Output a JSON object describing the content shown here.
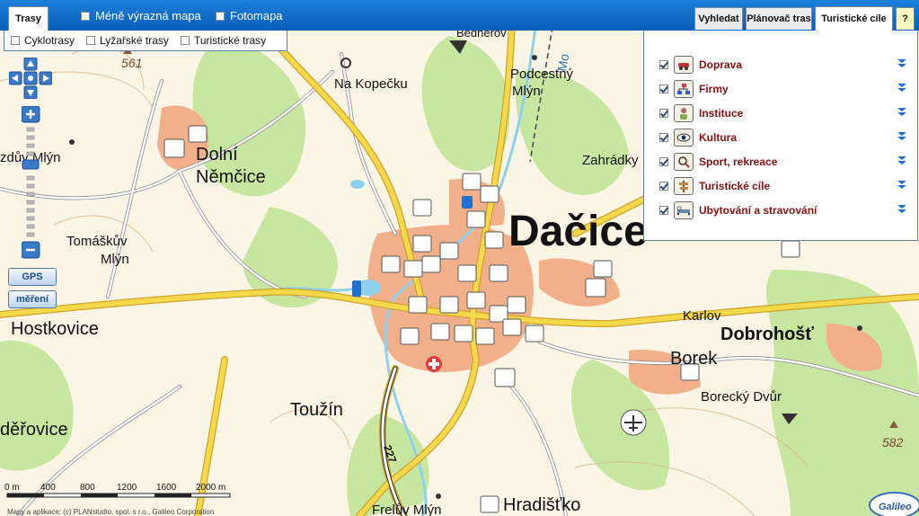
{
  "topbar": {
    "tab_routes": "Trasy",
    "less_map_label": "Méně výrazná mapa",
    "photo_map_label": "Fotomapa",
    "tab_search": "Vyhledat",
    "tab_planner": "Plánovač tras",
    "tab_tourist": "Turistické cíle",
    "tab_help": "?"
  },
  "routes_bar": {
    "cycle": "Cyklotrasy",
    "ski": "Lyžařské trasy",
    "hiking": "Turistické trasy"
  },
  "tourist_panel": {
    "items": [
      {
        "label": "Doprava",
        "icon": "car-icon"
      },
      {
        "label": "Firmy",
        "icon": "org-chart-icon"
      },
      {
        "label": "Instituce",
        "icon": "person-icon"
      },
      {
        "label": "Kultura",
        "icon": "eye-icon"
      },
      {
        "label": "Sport, rekreace",
        "icon": "magnifier-icon"
      },
      {
        "label": "Turistické cíle",
        "icon": "signpost-icon"
      },
      {
        "label": "Ubytování a stravování",
        "icon": "bed-icon"
      }
    ]
  },
  "controls": {
    "gps": "GPS",
    "measure": "měření"
  },
  "map_labels": {
    "dolni_nemcice_1": "Dolní",
    "dolni_nemcice_2": "Němčice",
    "na_kopecku": "Na Kopečku",
    "podcestny_1": "Podcestný",
    "podcestny_2": "Mlýn",
    "zahradky": "Zahrádky",
    "dacice": "Dačice",
    "zdov_mlyn": "zdův Mlýn",
    "tomaskuv_1": "Tomáškův",
    "tomaskuv_2": "Mlýn",
    "hostkovice": "Hostkovice",
    "karlov": "Karlov",
    "dobrohost": "Dobrohošť",
    "borek": "Borek",
    "borecky": "Borecký Dvůr",
    "touzin": "Toužín",
    "derovice": "děřovice",
    "freluv": "Frelův Mlýn",
    "hradisko": "Hradišťko",
    "bednerov": "Bednerov",
    "mo": "Mo",
    "elev_561": "561",
    "elev_582": "582",
    "road_227": "227",
    "galileo": "Galileo"
  },
  "scale": {
    "labels": [
      "0 m",
      "400",
      "800",
      "1200",
      "1600",
      "2000 m"
    ]
  },
  "copyright": "Mapy a aplikace: (c) PLANstudio, spol. s r.o., Galileo Corporation",
  "colors": {
    "topbar": "#0a5fb6",
    "road_major": "#f5d94a",
    "road_outline": "#cfa32c",
    "forest": "#c7e6a0",
    "water": "#8ed1ec",
    "urban": "#f2b08a",
    "label_dark": "#8b1010"
  }
}
